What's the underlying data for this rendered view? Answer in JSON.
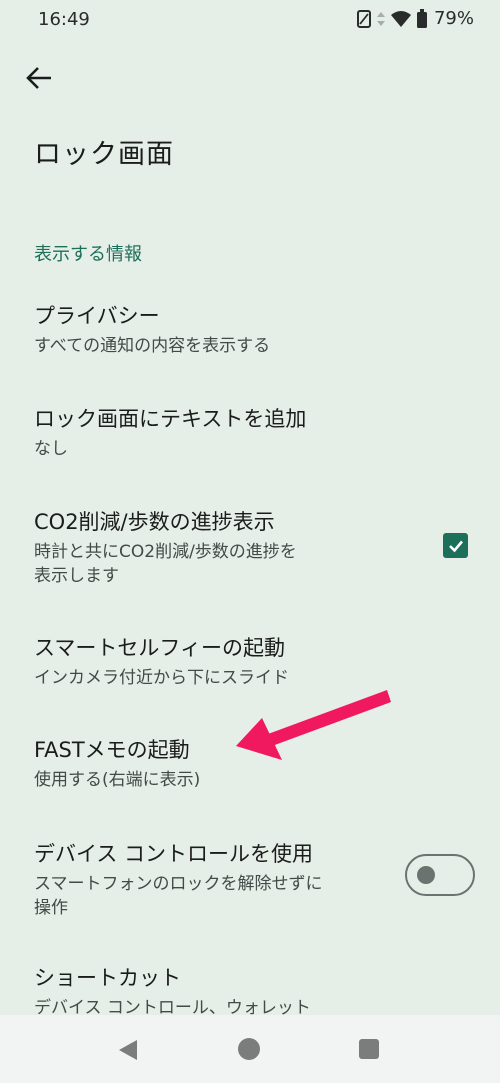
{
  "status_bar": {
    "time": "16:49",
    "battery_percent": "79%",
    "icons": [
      "vibrate-icon",
      "data-transfer-icon",
      "wifi-icon",
      "battery-icon"
    ]
  },
  "header": {
    "back_icon": "arrow-back-icon",
    "title": "ロック画面"
  },
  "section": {
    "header": "表示する情報"
  },
  "items": [
    {
      "title": "プライバシー",
      "summary": "すべての通知の内容を表示する"
    },
    {
      "title": "ロック画面にテキストを追加",
      "summary": "なし"
    },
    {
      "title": "CO2削減/歩数の進捗表示",
      "summary_line1": "時計と共にCO2削減/歩数の進捗を",
      "summary_line2": "表示します",
      "checked": true
    },
    {
      "title": "スマートセルフィーの起動",
      "summary": "インカメラ付近から下にスライド"
    },
    {
      "title": "FASTメモの起動",
      "summary": "使用する(右端に表示)"
    },
    {
      "title": "デバイス コントロールを使用",
      "summary_line1": "スマートフォンのロックを解除せずに",
      "summary_line2": "操作",
      "toggle_on": false
    },
    {
      "title": "ショートカット",
      "summary": "デバイス コントロール、ウォレット"
    }
  ],
  "annotation": {
    "arrow_color": "#f0185f"
  },
  "colors": {
    "background": "#e6eee8",
    "accent": "#1d6f5a"
  },
  "nav_bar": {
    "icons": [
      "nav-back-icon",
      "nav-home-icon",
      "nav-recents-icon"
    ]
  }
}
